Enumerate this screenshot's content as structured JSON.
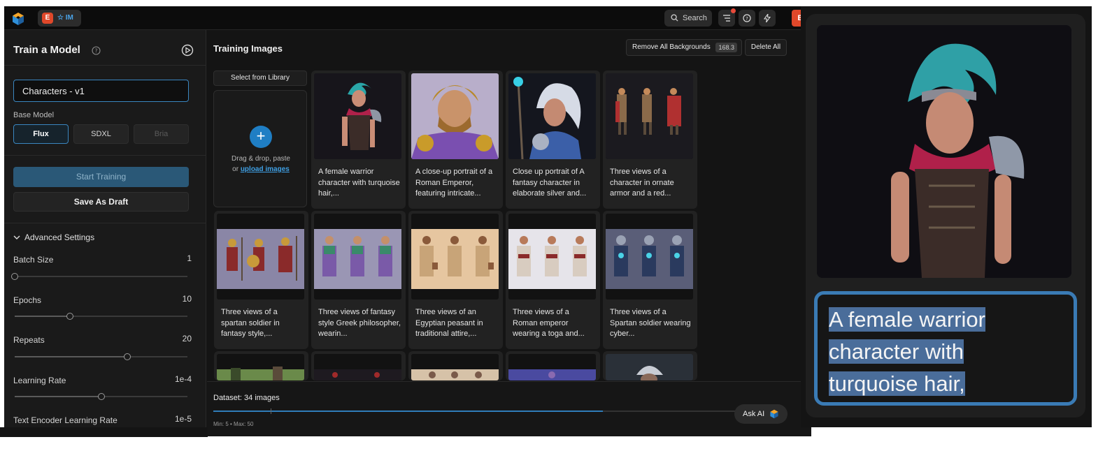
{
  "topbar": {
    "workspace_initial": "E",
    "workspace_badge": "IM",
    "search_label": "Search",
    "user_initial": "E"
  },
  "sidebar": {
    "title": "Train a Model",
    "model_name_value": "Characters - v1",
    "base_model_label": "Base Model",
    "base_models": [
      "Flux",
      "SDXL",
      "Bria"
    ],
    "selected_base_model": "Flux",
    "start_training_label": "Start Training",
    "save_draft_label": "Save As Draft",
    "advanced_label": "Advanced Settings",
    "params": [
      {
        "label": "Batch Size",
        "value": "1",
        "level": 0.0
      },
      {
        "label": "Epochs",
        "value": "10",
        "level": 0.32
      },
      {
        "label": "Repeats",
        "value": "20",
        "level": 0.65
      },
      {
        "label": "Learning Rate",
        "value": "1e-4",
        "level": 0.5
      },
      {
        "label": "Text Encoder Learning Rate",
        "value": "1e-5",
        "level": null
      }
    ]
  },
  "main": {
    "title": "Training Images",
    "remove_bg_label": "Remove All Backgrounds",
    "remove_bg_badge": "168.3",
    "delete_all_label": "Delete All",
    "select_library_label": "Select from Library",
    "drop_text": "Drag & drop, paste",
    "drop_or": "or",
    "upload_link": "upload images",
    "cards": [
      {
        "caption": "A female warrior character with turquoise hair,..."
      },
      {
        "caption": "A close-up portrait of a Roman Emperor, featuring intricate..."
      },
      {
        "caption": "Close up portrait of A fantasy character in elaborate silver and..."
      },
      {
        "caption": "Three views of a character in ornate armor and a red..."
      },
      {
        "caption": "Three views of a spartan soldier in fantasy style,..."
      },
      {
        "caption": "Three views of fantasy style Greek philosopher, wearin..."
      },
      {
        "caption": "Three views of an Egyptian peasant in traditional attire,..."
      },
      {
        "caption": "Three views of a Roman emperor wearing a toga and..."
      },
      {
        "caption": "Three views of a Spartan soldier wearing cyber..."
      }
    ],
    "dataset_label": "Dataset: 34 images",
    "dataset_progress": 0.733,
    "dataset_min_max": "Min: 5 • Max: 50",
    "ask_ai_label": "Ask AI"
  },
  "zoom": {
    "caption_lines": [
      "A female  warrior",
      "character with",
      "turquoise hair,"
    ]
  },
  "colors": {
    "accent": "#3a86c0",
    "brand_orange": "#e0482a",
    "link_blue": "#3fa0e5"
  }
}
